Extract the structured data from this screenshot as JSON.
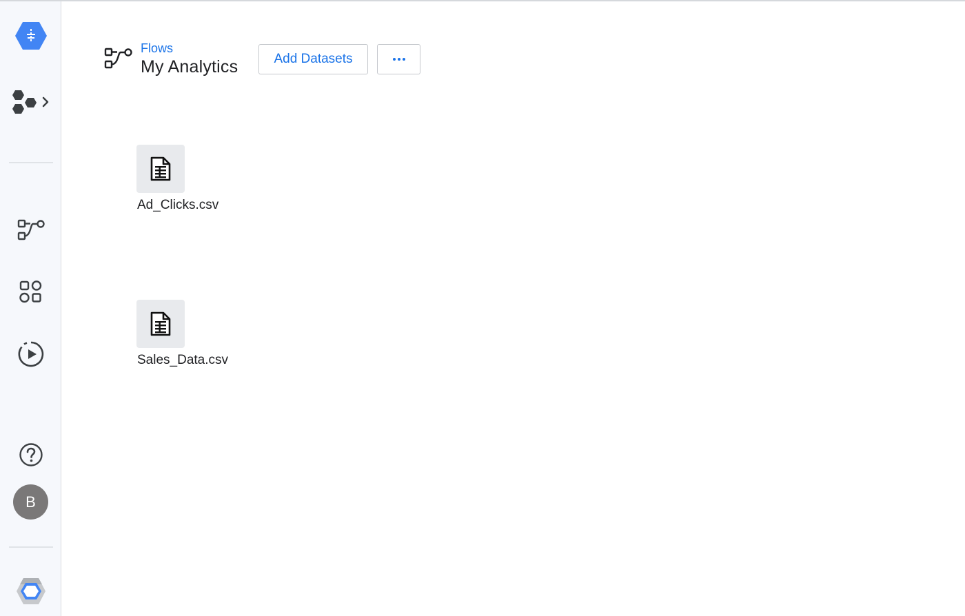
{
  "header": {
    "breadcrumb": "Flows",
    "title": "My Analytics",
    "add_datasets_label": "Add Datasets"
  },
  "sidebar": {
    "avatar_initial": "B"
  },
  "datasets": [
    {
      "name": "Ad_Clicks.csv"
    },
    {
      "name": "Sales_Data.csv"
    }
  ],
  "colors": {
    "accent": "#1a73e8",
    "logo_blue": "#4285f4",
    "sidebar_bg": "#f6f8fc",
    "tile_bg": "#e8eaed",
    "avatar_bg": "#7a7878"
  }
}
